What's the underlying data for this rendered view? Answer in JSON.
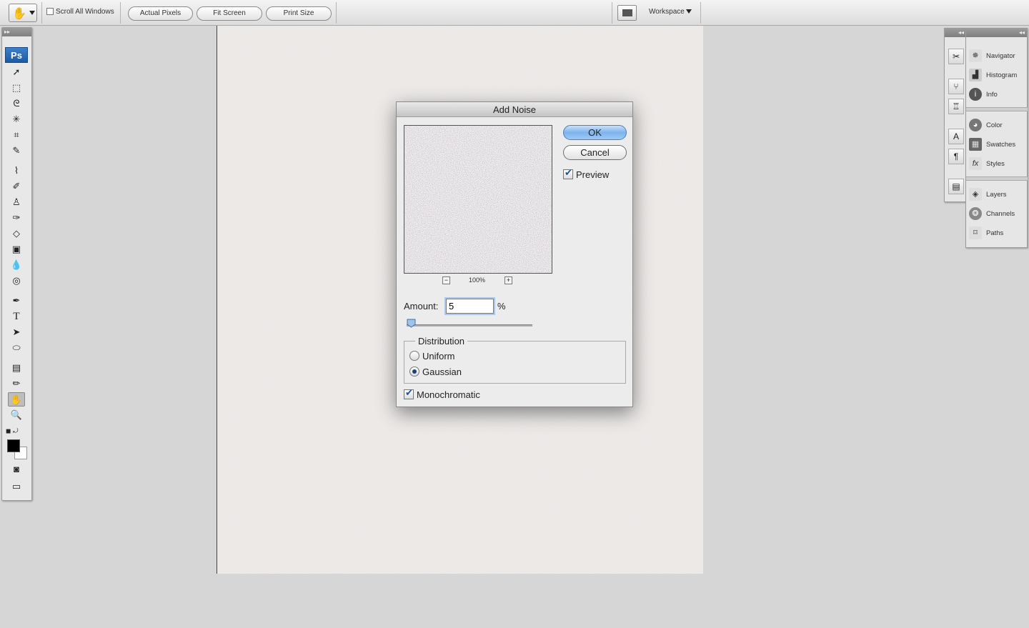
{
  "options_bar": {
    "scroll_all_windows": "Scroll All Windows",
    "buttons": [
      "Actual Pixels",
      "Fit Screen",
      "Print Size"
    ],
    "workspace": "Workspace"
  },
  "tools_panel": {
    "logo": "Ps",
    "icons": [
      "move-tool",
      "marquee-tool",
      "lasso-tool",
      "magic-wand-tool",
      "crop-tool",
      "slice-tool",
      "healing-brush-tool",
      "brush-tool",
      "clone-stamp-tool",
      "history-brush-tool",
      "eraser-tool",
      "gradient-tool",
      "blur-tool",
      "dodge-tool",
      "pen-tool",
      "type-tool",
      "path-selection-tool",
      "shape-tool",
      "notes-tool",
      "eyedropper-tool",
      "hand-tool",
      "zoom-tool"
    ],
    "foreground_color": "#000000",
    "background_color": "#ffffff"
  },
  "panels": {
    "group1": [
      "Navigator",
      "Histogram",
      "Info"
    ],
    "group2": [
      "Color",
      "Swatches",
      "Styles"
    ],
    "group3": [
      "Layers",
      "Channels",
      "Paths"
    ]
  },
  "dialog": {
    "title": "Add Noise",
    "ok": "OK",
    "cancel": "Cancel",
    "preview_label": "Preview",
    "preview_checked": true,
    "zoom": "100%",
    "zoom_out": "−",
    "zoom_in": "+",
    "amount_label": "Amount:",
    "amount_value": "5",
    "amount_unit": "%",
    "distribution_label": "Distribution",
    "uniform_label": "Uniform",
    "gaussian_label": "Gaussian",
    "selected_distribution": "Gaussian",
    "monochromatic_label": "Monochromatic",
    "monochromatic_checked": true,
    "accent_color": "#7eb3ec"
  }
}
